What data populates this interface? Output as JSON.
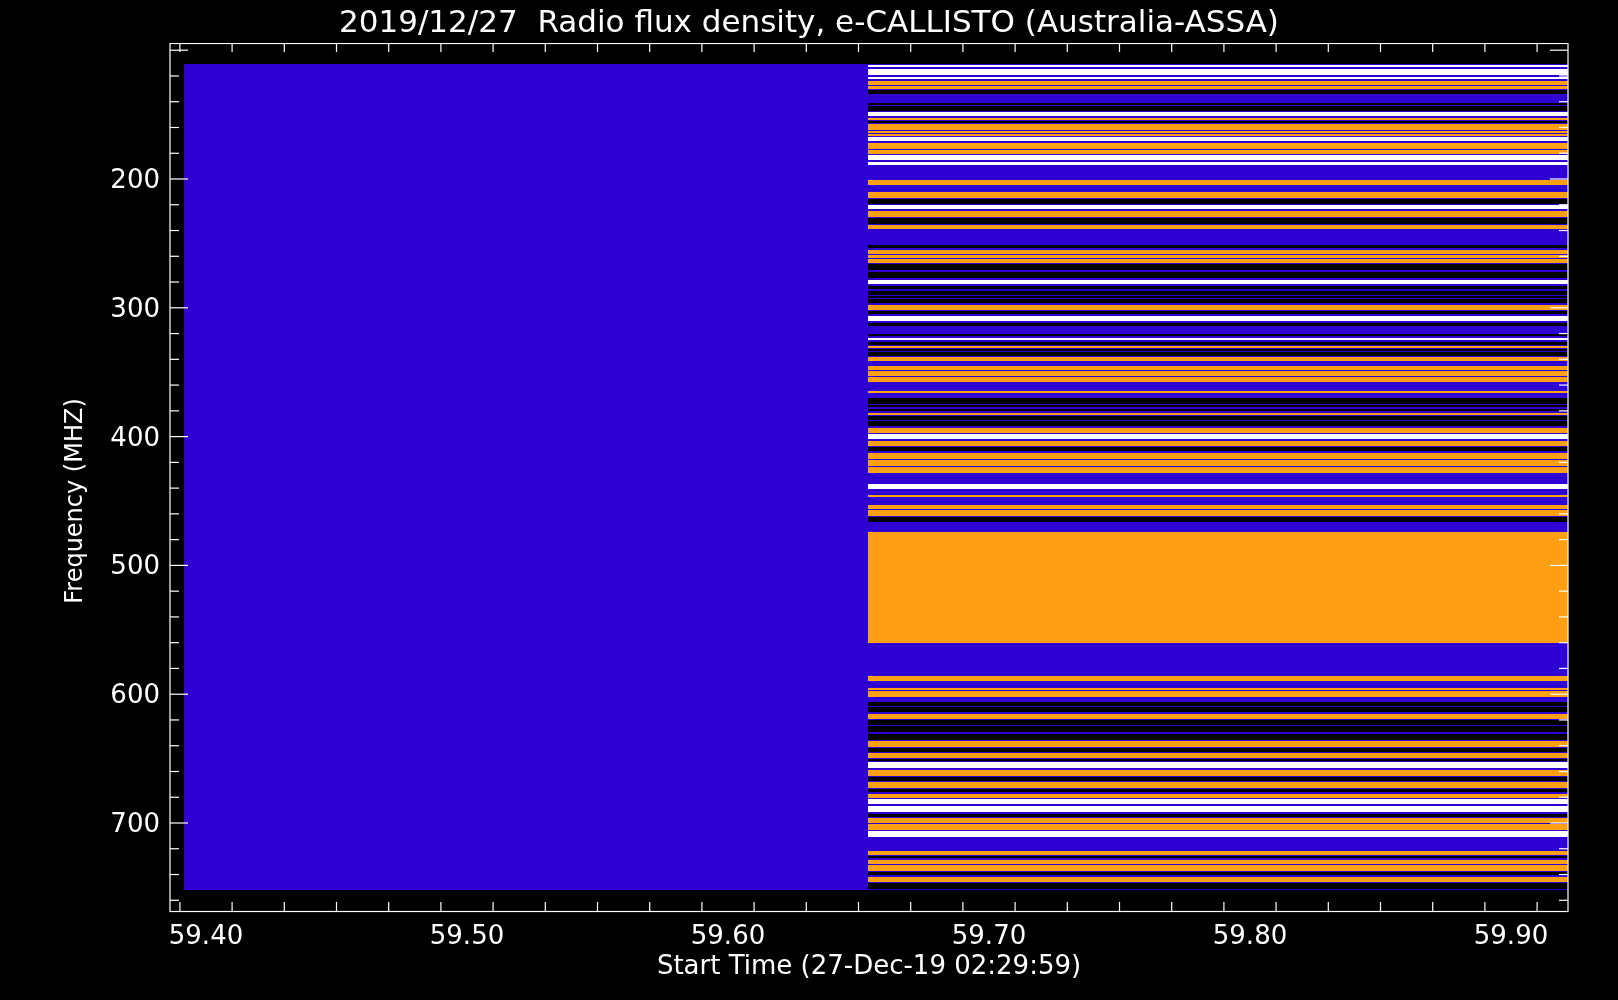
{
  "title": "2019/12/27  Radio flux density, e-CALLISTO (Australia-ASSA)",
  "plot": {
    "xlabel": "Start Time (27-Dec-19 02:29:59)",
    "ylabel": "Frequency (MHZ)",
    "xtick_labels": [
      "59.40",
      "59.50",
      "59.60",
      "59.70",
      "59.80",
      "59.90"
    ],
    "ytick_labels": [
      "200",
      "300",
      "400",
      "500",
      "600",
      "700"
    ]
  }
}
